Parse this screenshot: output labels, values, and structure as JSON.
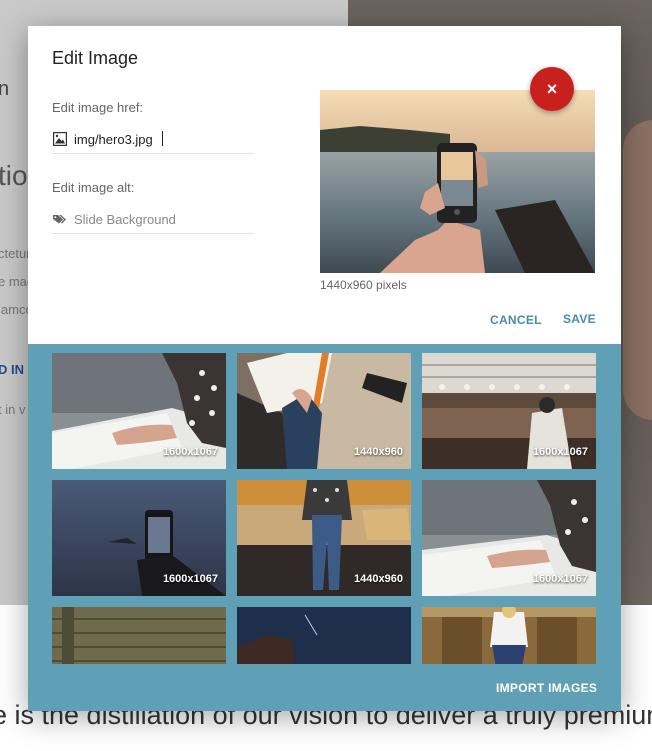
{
  "background": {
    "fragments": [
      "n",
      "tion",
      "ctetur",
      "e mag",
      "lamco",
      "D IN",
      "t in v"
    ],
    "bottom_text": "e is the distillation of our vision to deliver a truly premium experi"
  },
  "modal": {
    "title": "Edit Image",
    "href_label": "Edit image href:",
    "href_value": "img/hero3.jpg",
    "alt_label": "Edit image alt:",
    "alt_placeholder": "Slide Background",
    "preview_caption": "1440x960 pixels",
    "close_label": "×",
    "cancel_label": "CANCEL",
    "save_label": "SAVE"
  },
  "gallery": {
    "images": [
      {
        "dimensions": "1600x1067"
      },
      {
        "dimensions": "1440x960"
      },
      {
        "dimensions": "1600x1067"
      },
      {
        "dimensions": "1600x1067"
      },
      {
        "dimensions": "1440x960"
      },
      {
        "dimensions": "1600x1067"
      },
      {
        "dimensions": ""
      },
      {
        "dimensions": ""
      },
      {
        "dimensions": ""
      }
    ],
    "import_label": "IMPORT IMAGES"
  },
  "colors": {
    "modal_gallery_bg": "#5fa0b6",
    "accent": "#4a8ba8",
    "close_button": "#c8201c"
  }
}
